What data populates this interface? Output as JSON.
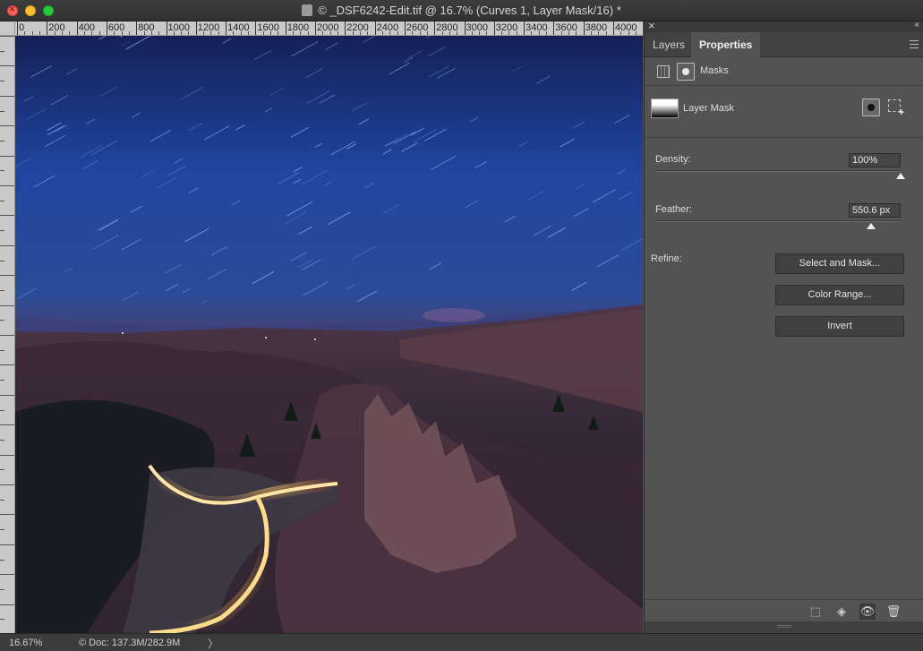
{
  "window": {
    "title": "© _DSF6242-Edit.tif @ 16.7% (Curves 1, Layer Mask/16) *"
  },
  "ruler": {
    "top_labels": [
      "0",
      "200",
      "400",
      "600",
      "800",
      "1000",
      "1200",
      "1400",
      "1600",
      "1800",
      "2000",
      "2200",
      "2400",
      "2600",
      "2800",
      "3000",
      "3200",
      "3400",
      "3600",
      "3800",
      "4000"
    ]
  },
  "panel": {
    "close": "×",
    "collapse": "«",
    "tabs": [
      {
        "label": "Layers",
        "active": false
      },
      {
        "label": "Properties",
        "active": true
      }
    ],
    "masks_label": "Masks",
    "layer_mask_label": "Layer Mask",
    "density": {
      "label": "Density:",
      "value": "100%",
      "level": 1.0
    },
    "feather": {
      "label": "Feather:",
      "value": "550.6 px",
      "level": 0.88
    },
    "refine_label": "Refine:",
    "buttons": {
      "select_and_mask": "Select and Mask...",
      "color_range": "Color Range...",
      "invert": "Invert"
    }
  },
  "status": {
    "zoom": "16.67%",
    "doc": "© Doc: 137.3M/282.9M",
    "arrow": "〉"
  },
  "colors": {
    "sky_top": "#1a2a66",
    "sky_bottom": "#2a55a8",
    "rock": "#3a2a3a",
    "light_trail": "#ffd27a"
  },
  "icons": {
    "mask_pixel": "pixel-mask-icon",
    "vector_mask": "vector-mask-icon",
    "eye": "eye-icon",
    "trash": "trash-icon"
  }
}
